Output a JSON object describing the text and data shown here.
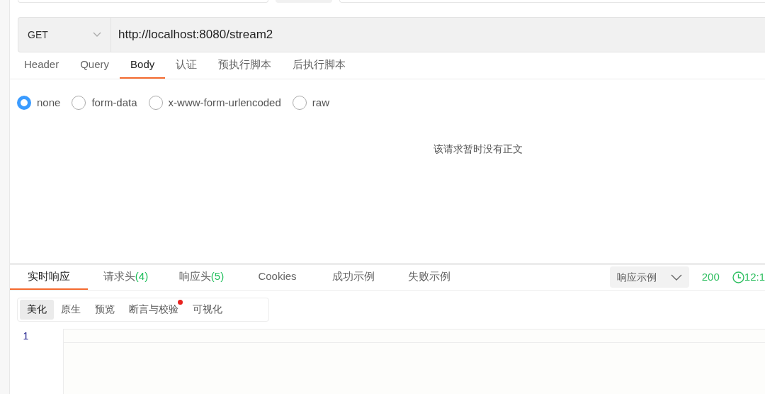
{
  "request": {
    "method": "GET",
    "url": "http://localhost:8080/stream2"
  },
  "request_tabs": [
    {
      "label": "Header",
      "selected": false
    },
    {
      "label": "Query",
      "selected": false
    },
    {
      "label": "Body",
      "selected": true
    },
    {
      "label": "认证",
      "selected": false
    },
    {
      "label": "预执行脚本",
      "selected": false
    },
    {
      "label": "后执行脚本",
      "selected": false
    }
  ],
  "body_types": [
    {
      "label": "none",
      "selected": true
    },
    {
      "label": "form-data",
      "selected": false
    },
    {
      "label": "x-www-form-urlencoded",
      "selected": false
    },
    {
      "label": "raw",
      "selected": false
    }
  ],
  "empty_message": "该请求暂时没有正文",
  "response_tabs": [
    {
      "label": "实时响应",
      "selected": true
    },
    {
      "label": "请求头",
      "count": "(4)",
      "selected": false
    },
    {
      "label": "响应头",
      "count": "(5)",
      "selected": false
    },
    {
      "label": "Cookies",
      "selected": false
    },
    {
      "label": "成功示例",
      "selected": false
    },
    {
      "label": "失败示例",
      "selected": false
    }
  ],
  "example_select": "响应示例",
  "status": "200",
  "time": "12:1",
  "view_tabs": [
    {
      "label": "美化",
      "selected": true,
      "dot": false
    },
    {
      "label": "原生",
      "selected": false,
      "dot": false
    },
    {
      "label": "预览",
      "selected": false,
      "dot": false
    },
    {
      "label": "断言与校验",
      "selected": false,
      "dot": true
    },
    {
      "label": "可视化",
      "selected": false,
      "dot": false
    }
  ],
  "editor": {
    "line_numbers": [
      "1"
    ]
  }
}
